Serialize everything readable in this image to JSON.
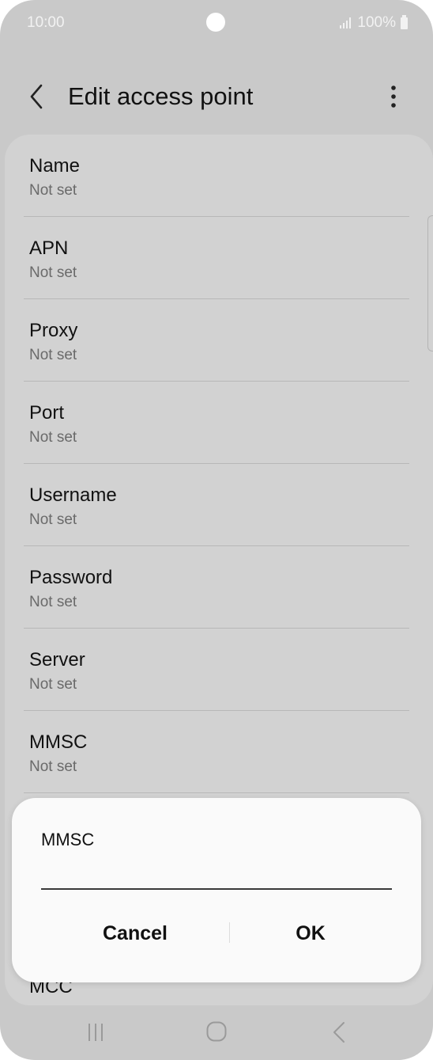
{
  "status_bar": {
    "time": "10:00",
    "battery": "100%",
    "signal_icon": "signal-icon",
    "battery_icon": "battery-icon"
  },
  "header": {
    "title": "Edit access point",
    "back_icon": "chevron-left-icon",
    "more_icon": "more-vertical-icon"
  },
  "list": {
    "items": [
      {
        "title": "Name",
        "value": "Not set"
      },
      {
        "title": "APN",
        "value": "Not set"
      },
      {
        "title": "Proxy",
        "value": "Not set"
      },
      {
        "title": "Port",
        "value": "Not set"
      },
      {
        "title": "Username",
        "value": "Not set"
      },
      {
        "title": "Password",
        "value": "Not set"
      },
      {
        "title": "Server",
        "value": "Not set"
      },
      {
        "title": "MMSC",
        "value": "Not set"
      }
    ],
    "partial_item_title": "MCC"
  },
  "dialog": {
    "title": "MMSC",
    "input_value": "",
    "cancel_label": "Cancel",
    "ok_label": "OK"
  },
  "nav_bar": {
    "recents_icon": "recents-icon",
    "home_icon": "home-icon",
    "back_icon": "back-icon"
  },
  "colors": {
    "background_dimmed": "#c9c9c9",
    "dialog_background": "#fafafa",
    "text_primary": "#111111",
    "text_secondary": "#6a6a6a"
  }
}
